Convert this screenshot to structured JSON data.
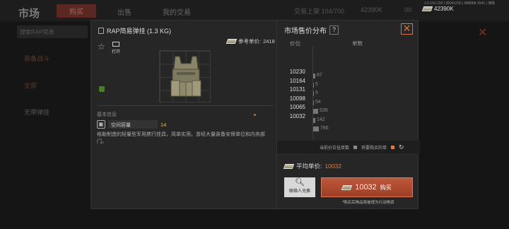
{
  "background": {
    "title": "市场",
    "tabs": [
      "购买",
      "出售",
      "我的交易"
    ],
    "currency_a": "交易上架 104/700",
    "currency_b": "42390K",
    "currency_c": "00",
    "search_placeholder": "搜索RAP简易",
    "side_items": [
      "装备战斗",
      "全部",
      "无带弹挂"
    ],
    "version": "1.0.150.150 | 06041236 | 888888 2041 | 演练"
  },
  "topbar": {
    "balance": "42390K"
  },
  "item": {
    "name": "RAP简易弹挂 (1.3 KG)",
    "ref_price_label": "参考单价:",
    "ref_price": "2418",
    "open_label": "打开",
    "section_label": "基本信息",
    "capacity_label": "空间容量",
    "capacity_value": "14",
    "description": "格勒制造的轻量型军用携行挂具，简单实用。曾经大量装备安保单位和内务部门。"
  },
  "market": {
    "title": "市场售价分布",
    "help": "?",
    "col_price": "价位",
    "col_count": "单数",
    "rows": [
      {
        "price": "10230",
        "count": "87",
        "fraction": 0.02
      },
      {
        "price": "10164",
        "count": "5",
        "fraction": 0.0
      },
      {
        "price": "10131",
        "count": "5",
        "fraction": 0.0
      },
      {
        "price": "10098",
        "count": "54",
        "fraction": 0.01
      },
      {
        "price": "10065",
        "count": "539",
        "fraction": 0.05
      },
      {
        "price": "10032",
        "count": "142",
        "fraction": 0.02
      },
      {
        "price": "",
        "count": "766",
        "fraction": 0.06
      }
    ],
    "legend_current": "当前价位挂单数",
    "legend_mine": "将要购买的单",
    "avg_label": "平均单价:",
    "avg_value": "10032",
    "exchange_label": "联络人兑换",
    "buy_price": "10032",
    "buy_label": "购买",
    "note": "*购买后物品将被视为行动物资"
  },
  "colors": {
    "accent": "#e8792e",
    "buy_button": "#b04a2e",
    "capacity": "#e8b84a"
  }
}
